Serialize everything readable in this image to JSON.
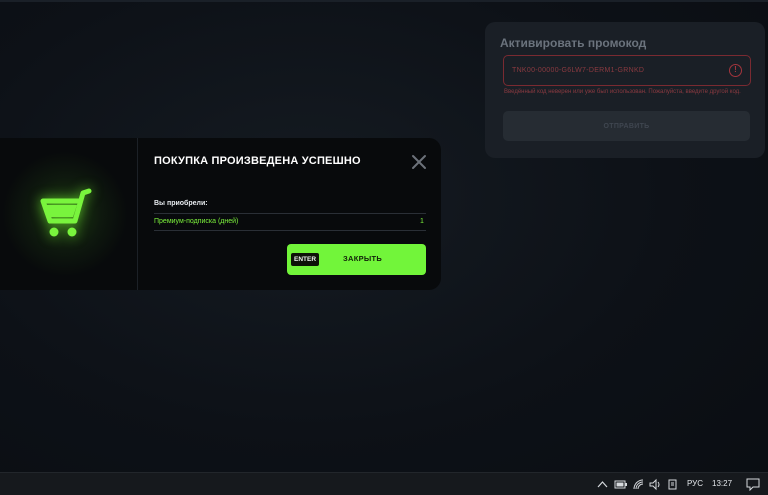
{
  "promo": {
    "title": "Активировать промокод",
    "code_value": "TNK00-00000-G6LW7-DERM1-GRNKD",
    "error_text": "Введённый код неверен или уже был использован. Пожалуйста, введите другой код.",
    "submit_label": "ОТПРАВИТЬ",
    "colors": {
      "error": "#8a3a40",
      "panel": "#1a1f26"
    }
  },
  "modal": {
    "title": "ПОКУПКА ПРОИЗВЕДЕНА УСПЕШНО",
    "purchased_label": "Вы приобрели:",
    "items": [
      {
        "name": "Премиум-подписка (дней)",
        "quantity": "1"
      }
    ],
    "action": {
      "key_hint": "ENTER",
      "label": "ЗАКРЫТЬ"
    },
    "colors": {
      "accent": "#72f53a"
    },
    "icon": "shopping-cart-icon"
  },
  "taskbar": {
    "language": "РУС",
    "time": "13:27",
    "icons": [
      "chevron-up-icon",
      "battery-icon",
      "wifi-icon",
      "volume-icon",
      "device-icon",
      "notification-icon"
    ]
  }
}
